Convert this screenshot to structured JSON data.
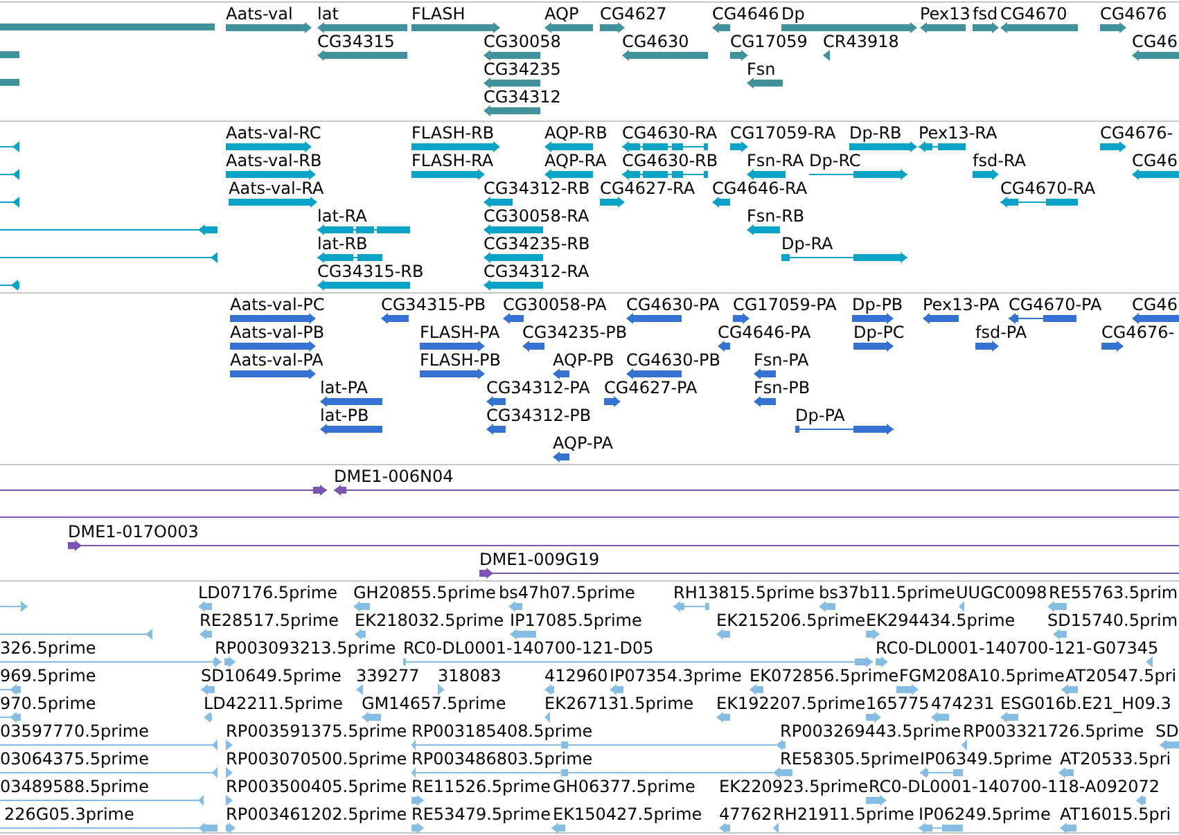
{
  "tracks": [
    {
      "kind": "gene",
      "features": [
        {
          "label": "Aats-val",
          "reverse": false
        },
        {
          "label": "lat",
          "reverse": true
        },
        {
          "label": "FLASH",
          "reverse": false
        },
        {
          "label": "AQP",
          "reverse": true
        },
        {
          "label": "CG4627",
          "reverse": false
        },
        {
          "label": "CG4646",
          "reverse": true
        },
        {
          "label": "Dp",
          "reverse": false
        },
        {
          "label": "Pex13",
          "reverse": true
        },
        {
          "label": "fsd",
          "reverse": false
        },
        {
          "label": "CG4670",
          "reverse": true
        },
        {
          "label": "CG4676",
          "reverse": false
        },
        {
          "label": "CG34315",
          "reverse": true
        },
        {
          "label": "CG30058",
          "reverse": true
        },
        {
          "label": "CG4630",
          "reverse": true
        },
        {
          "label": "CG17059",
          "reverse": false
        },
        {
          "label": "CR43918",
          "reverse": true
        },
        {
          "label": "CG46",
          "reverse": true
        },
        {
          "label": "CG34235",
          "reverse": true
        },
        {
          "label": "Fsn",
          "reverse": true
        },
        {
          "label": "CG34312",
          "reverse": true
        }
      ]
    },
    {
      "kind": "transcript",
      "features": [
        {
          "reverse": true
        },
        {
          "label": "Aats-val-RC",
          "reverse": false
        },
        {
          "label": "FLASH-RB",
          "reverse": false
        },
        {
          "label": "AQP-RB",
          "reverse": true
        },
        {
          "label": "CG4630-RA",
          "reverse": true
        },
        {
          "label": "CG17059-RA",
          "reverse": false
        },
        {
          "label": "Dp-RB",
          "reverse": false
        },
        {
          "label": "Pex13-RA",
          "reverse": true
        },
        {
          "label": "CG4676-",
          "reverse": false
        },
        {
          "reverse": true
        },
        {
          "label": "Aats-val-RB",
          "reverse": false
        },
        {
          "label": "FLASH-RA",
          "reverse": false
        },
        {
          "label": "AQP-RA",
          "reverse": true
        },
        {
          "label": "CG4630-RB",
          "reverse": true
        },
        {
          "label": "Fsn-RA",
          "reverse": true
        },
        {
          "label": "Dp-RC",
          "reverse": false
        },
        {
          "label": "fsd-RA",
          "reverse": false
        },
        {
          "label": "CG46",
          "reverse": true
        },
        {
          "reverse": true
        },
        {
          "label": "Aats-val-RA",
          "reverse": false
        },
        {
          "label": "CG34312-RB",
          "reverse": true
        },
        {
          "label": "CG4627-RA",
          "reverse": false
        },
        {
          "label": "CG4646-RA",
          "reverse": true
        },
        {
          "label": "CG4670-RA",
          "reverse": true
        },
        {
          "reverse": true
        },
        {
          "label": "lat-RA",
          "reverse": true
        },
        {
          "label": "CG30058-RA",
          "reverse": true
        },
        {
          "label": "Fsn-RB",
          "reverse": true
        },
        {
          "reverse": true
        },
        {
          "label": "lat-RB",
          "reverse": true
        },
        {
          "label": "CG34235-RB",
          "reverse": true
        },
        {
          "label": "Dp-RA",
          "reverse": false
        },
        {
          "reverse": true
        },
        {
          "label": "CG34315-RB",
          "reverse": true
        },
        {
          "label": "CG34312-RA",
          "reverse": true
        }
      ]
    },
    {
      "kind": "protein",
      "features": [
        {
          "label": "Aats-val-PC",
          "reverse": false
        },
        {
          "label": "CG34315-PB",
          "reverse": true
        },
        {
          "label": "CG30058-PA",
          "reverse": true
        },
        {
          "label": "CG4630-PA",
          "reverse": true
        },
        {
          "label": "CG17059-PA",
          "reverse": false
        },
        {
          "label": "Dp-PB",
          "reverse": false
        },
        {
          "label": "Pex13-PA",
          "reverse": true
        },
        {
          "label": "CG4670-PA",
          "reverse": true
        },
        {
          "label": "CG46",
          "reverse": true
        },
        {
          "label": "Aats-val-PB",
          "reverse": false
        },
        {
          "label": "FLASH-PA",
          "reverse": false
        },
        {
          "label": "CG34235-PB",
          "reverse": true
        },
        {
          "label": "CG4646-PA",
          "reverse": true
        },
        {
          "label": "Dp-PC",
          "reverse": false
        },
        {
          "label": "fsd-PA",
          "reverse": false
        },
        {
          "label": "CG4676-",
          "reverse": false
        },
        {
          "label": "Aats-val-PA",
          "reverse": false
        },
        {
          "label": "FLASH-PB",
          "reverse": false
        },
        {
          "label": "AQP-PB",
          "reverse": true
        },
        {
          "label": "CG4630-PB",
          "reverse": true
        },
        {
          "label": "Fsn-PA",
          "reverse": true
        },
        {
          "label": "lat-PA",
          "reverse": true
        },
        {
          "label": "CG34312-PA",
          "reverse": true
        },
        {
          "label": "CG4627-PA",
          "reverse": false
        },
        {
          "label": "Fsn-PB",
          "reverse": true
        },
        {
          "label": "lat-PB",
          "reverse": true
        },
        {
          "label": "CG34312-PB",
          "reverse": true
        },
        {
          "label": "Dp-PA",
          "reverse": false
        },
        {
          "label": "AQP-PA",
          "reverse": true
        }
      ]
    },
    {
      "kind": "clone",
      "features": [
        {
          "reverse": false
        },
        {
          "label": "DME1-006N04",
          "reverse": true
        },
        {
          "label": "DME1-017O003",
          "reverse": false
        },
        {
          "label": "DME1-009G19",
          "reverse": false
        }
      ]
    },
    {
      "kind": "est",
      "features": [
        {
          "reverse": false
        },
        {
          "label": "LD07176.5prime",
          "reverse": true
        },
        {
          "label": "GH20855.5prime",
          "reverse": true
        },
        {
          "label": "bs47h07.5prime",
          "reverse": true
        },
        {
          "label": "RH13815.5prime",
          "reverse": true
        },
        {
          "label": "bs37b11.5prime",
          "reverse": true
        },
        {
          "label": "UUGC0098",
          "reverse": true
        },
        {
          "label": "RE55763.5prim",
          "reverse": true
        },
        {
          "reverse": true
        },
        {
          "label": "RE28517.5prime",
          "reverse": true
        },
        {
          "label": "EK218032.5prime",
          "reverse": true
        },
        {
          "label": "IP17085.5prime",
          "reverse": true
        },
        {
          "label": "EK215206.5prime",
          "reverse": true
        },
        {
          "label": "EK294434.5prime",
          "reverse": false
        },
        {
          "label": "SD15740.5prim",
          "reverse": true
        },
        {
          "label": "326.5prime",
          "reverse": false
        },
        {
          "label": "RP003093213.5prime",
          "reverse": false
        },
        {
          "label": "RC0-DL0001-140700-121-D05",
          "reverse": false
        },
        {
          "label": "RC0-DL0001-140700-121-G07345",
          "reverse": false
        },
        {
          "reverse": true
        },
        {
          "label": "969.5prime",
          "reverse": true
        },
        {
          "label": "SD10649.5prime",
          "reverse": true
        },
        {
          "label": "339277",
          "reverse": true
        },
        {
          "label": "318083",
          "reverse": false
        },
        {
          "label": "412960",
          "reverse": true
        },
        {
          "label": "IP07354.3prime",
          "reverse": true
        },
        {
          "label": "EK072856.5prime",
          "reverse": true
        },
        {
          "label": "FGM208A10.5prime",
          "reverse": false
        },
        {
          "label": "AT20547.5pri",
          "reverse": true
        },
        {
          "label": "970.5prime",
          "reverse": true
        },
        {
          "label": "LD42211.5prime",
          "reverse": true
        },
        {
          "label": "GM14657.5prime",
          "reverse": true
        },
        {
          "label": "EK267131.5prime",
          "reverse": true
        },
        {
          "label": "EK192207.5prime",
          "reverse": true
        },
        {
          "label": "165775",
          "reverse": false
        },
        {
          "label": "474231",
          "reverse": true
        },
        {
          "label": "ESG016b.E21_H09.3",
          "reverse": true
        },
        {
          "label": "03597770.5prime",
          "reverse": true
        },
        {
          "label": "RP003591375.5prime",
          "reverse": false
        },
        {
          "label": "RP003185408.5prime",
          "reverse": true
        },
        {
          "label": "RP003269443.5prime",
          "reverse": true
        },
        {
          "label": "RP003321726.5prime",
          "reverse": true
        },
        {
          "label": "SD",
          "reverse": true
        },
        {
          "label": "03064375.5prime",
          "reverse": true
        },
        {
          "label": "RP003070500.5prime",
          "reverse": false
        },
        {
          "label": "RP003486803.5prime",
          "reverse": true
        },
        {
          "label": "RE58305.5prime",
          "reverse": true
        },
        {
          "label": "IP06349.5prime",
          "reverse": true
        },
        {
          "label": "AT20533.5pri",
          "reverse": true
        },
        {
          "label": "03489588.5prime",
          "reverse": true
        },
        {
          "label": "RP003500405.5prime",
          "reverse": false
        },
        {
          "label": "RE11526.5prime",
          "reverse": false
        },
        {
          "label": "GH06377.5prime"
        },
        {
          "label": "EK220923.5prime"
        },
        {
          "label": "RC0-DL0001-140700-118-A092072",
          "reverse": false
        },
        {
          "reverse": true
        },
        {
          "label": "226G05.3prime",
          "reverse": true
        },
        {
          "label": "RP003461202.5prime",
          "reverse": false
        },
        {
          "label": "RE53479.5prime",
          "reverse": false
        },
        {
          "label": "EK150427.5prime",
          "reverse": true
        },
        {
          "label": "47762",
          "reverse": true
        },
        {
          "label": "RH21911.5prime",
          "reverse": true
        },
        {
          "label": "IP06249.5prime",
          "reverse": true
        },
        {
          "label": "AT16015.5pri",
          "reverse": true
        }
      ]
    }
  ]
}
